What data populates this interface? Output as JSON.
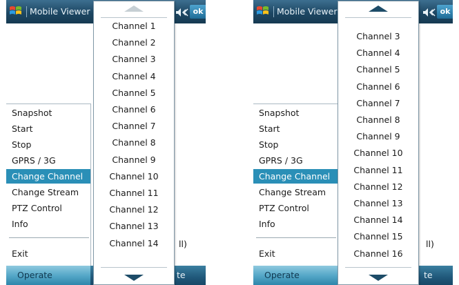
{
  "title_bar": {
    "app_title": "Mobile Viewer",
    "ok_label": "ok"
  },
  "operate_menu": {
    "items": [
      "Snapshot",
      "Start",
      "Stop",
      "GPRS / 3G",
      "Change Channel",
      "Change Stream",
      "PTZ Control",
      "Info"
    ],
    "exit_label": "Exit",
    "selected_item": "Change Channel"
  },
  "softkeys": {
    "left": "Operate",
    "right": "te"
  },
  "background_fragment": "ll)",
  "left_screen": {
    "channels": [
      "Channel 1",
      "Channel 2",
      "Channel 3",
      "Channel 4",
      "Channel 5",
      "Channel 6",
      "Channel 7",
      "Channel 8",
      "Channel 9",
      "Channel 10",
      "Channel 11",
      "Channel 12",
      "Channel 13",
      "Channel 14"
    ],
    "scroll_up_enabled": false,
    "scroll_down_enabled": true
  },
  "right_screen": {
    "channels": [
      "Channel 3",
      "Channel 4",
      "Channel 5",
      "Channel 6",
      "Channel 7",
      "Channel 8",
      "Channel 9",
      "Channel 10",
      "Channel 11",
      "Channel 12",
      "Channel 13",
      "Channel 14",
      "Channel 15",
      "Channel 16"
    ],
    "scroll_up_enabled": true,
    "scroll_down_enabled": true
  },
  "colors": {
    "title_bar": "#1d4763",
    "selection": "#2a8fb7",
    "softkey_bar": "#20587a",
    "ok_button": "#2f86b5"
  },
  "icons": {
    "start": "windows-flag-icon",
    "volume": "speaker-icon",
    "scroll_up": "triangle-up-icon",
    "scroll_down": "triangle-down-icon"
  }
}
